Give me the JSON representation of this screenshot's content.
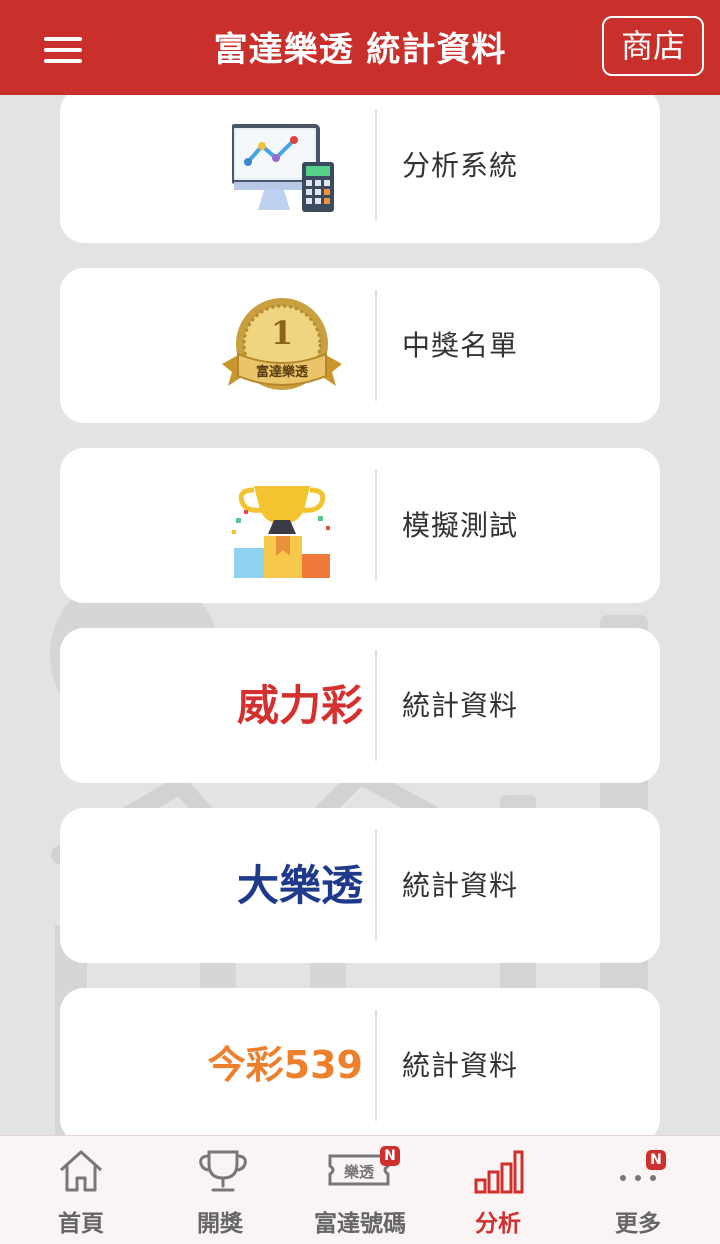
{
  "header": {
    "title": "富達樂透 統計資料",
    "shop_label": "商店",
    "accent": "#c9302c"
  },
  "cards": [
    {
      "icon": "analysis-system-icon",
      "label": "分析系統"
    },
    {
      "icon": "gold-medal-icon",
      "medal_text": "富達樂透",
      "medal_number": "1",
      "label": "中獎名單"
    },
    {
      "icon": "trophy-podium-icon",
      "label": "模擬測試"
    },
    {
      "brand": "威力彩",
      "brand_color": "#d43030",
      "label": "統計資料"
    },
    {
      "brand": "大樂透",
      "brand_color": "#1f3a8a",
      "label": "統計資料"
    },
    {
      "brand": "今彩539",
      "brand_color": "#ee7f2d",
      "label": "統計資料"
    }
  ],
  "tabbar": {
    "items": [
      {
        "icon": "home-icon",
        "label": "首頁"
      },
      {
        "icon": "trophy-icon",
        "label": "開獎"
      },
      {
        "icon": "ticket-icon",
        "label": "富達號碼",
        "ticket_text": "樂透",
        "badge": "N"
      },
      {
        "icon": "bar-chart-icon",
        "label": "分析",
        "active": true
      },
      {
        "icon": "more-icon",
        "label": "更多",
        "badge": "N"
      }
    ],
    "active_color": "#d0302d"
  }
}
